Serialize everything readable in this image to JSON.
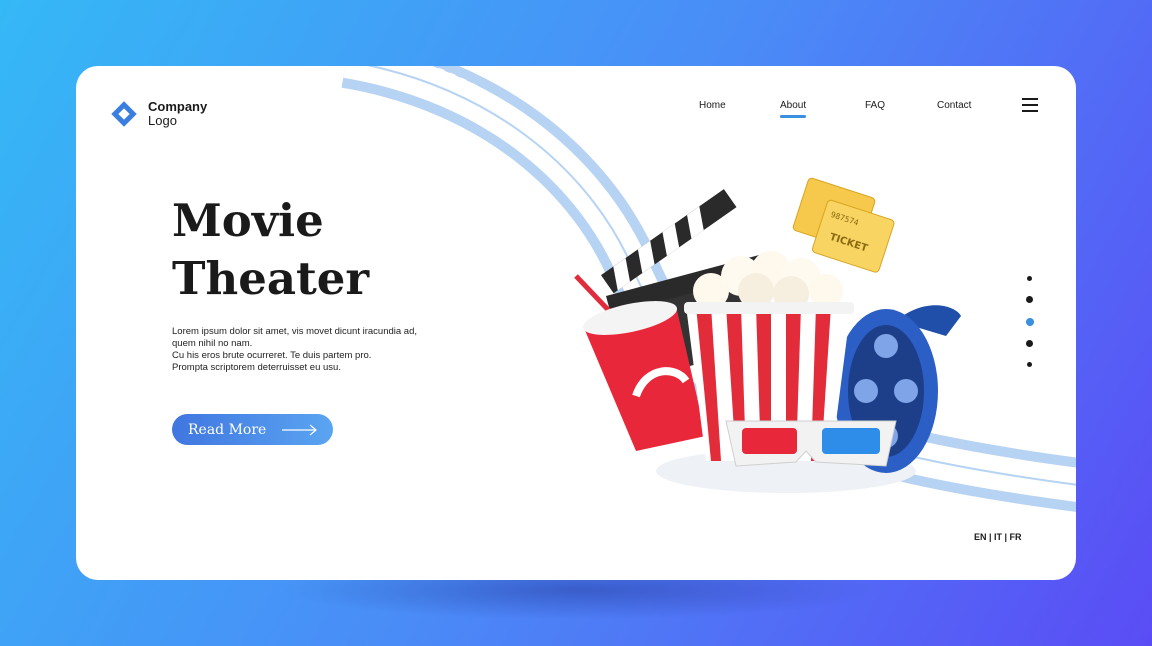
{
  "logo": {
    "line1": "Company",
    "line2": "Logo",
    "icon": "diamond-logo-icon",
    "color": "#3a7fe0"
  },
  "nav": {
    "items": [
      {
        "label": "Home",
        "active": false
      },
      {
        "label": "About",
        "active": true
      },
      {
        "label": "FAQ",
        "active": false
      },
      {
        "label": "Contact",
        "active": false
      }
    ],
    "menu_icon": "hamburger-menu-icon"
  },
  "hero": {
    "title_line1": "Movie",
    "title_line2": "Theater",
    "body_lines": [
      "Lorem ipsum dolor sit amet, vis movet dicunt iracundia ad,",
      "quem nihil no nam.",
      "Cu his eros brute ocurreret. Te duis partem pro.",
      "Prompta scriptorem deterruisset eu usu."
    ],
    "cta_label": "Read More",
    "cta_icon": "arrow-right-icon"
  },
  "illustration": {
    "ticket_text": "987574",
    "ticket_label": "TICKET"
  },
  "pagination": {
    "count": 5,
    "active_index": 2,
    "accent": "#3a8fe0"
  },
  "languages": {
    "text": "EN | IT | FR"
  },
  "colors": {
    "accent": "#3a8fe0",
    "background_start": "#35b8f6",
    "background_end": "#5a4cf5"
  }
}
